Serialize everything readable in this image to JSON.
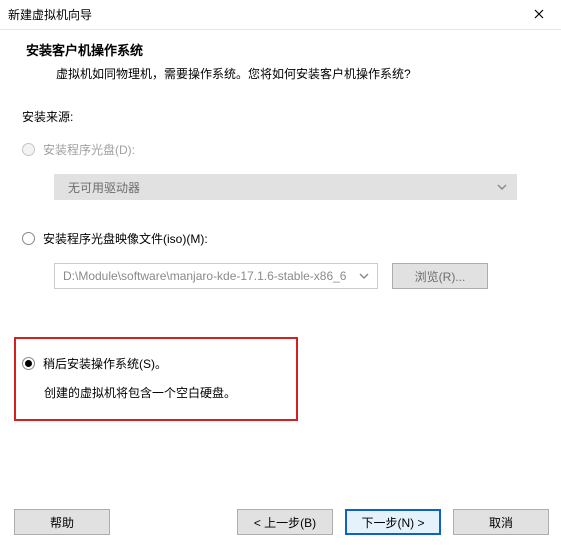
{
  "window": {
    "title": "新建虚拟机向导"
  },
  "header": {
    "title": "安装客户机操作系统",
    "subtitle": "虚拟机如同物理机，需要操作系统。您将如何安装客户机操作系统?"
  },
  "source": {
    "label": "安装来源:",
    "option_disc": {
      "label": "安装程序光盘(D):",
      "dropdown_text": "无可用驱动器"
    },
    "option_iso": {
      "label": "安装程序光盘映像文件(iso)(M):",
      "path": "D:\\Module\\software\\manjaro-kde-17.1.6-stable-x86_6",
      "browse_label": "浏览(R)..."
    },
    "option_later": {
      "label": "稍后安装操作系统(S)。",
      "hint": "创建的虚拟机将包含一个空白硬盘。"
    }
  },
  "footer": {
    "help": "帮助",
    "back": "< 上一步(B)",
    "next": "下一步(N) >",
    "cancel": "取消"
  }
}
